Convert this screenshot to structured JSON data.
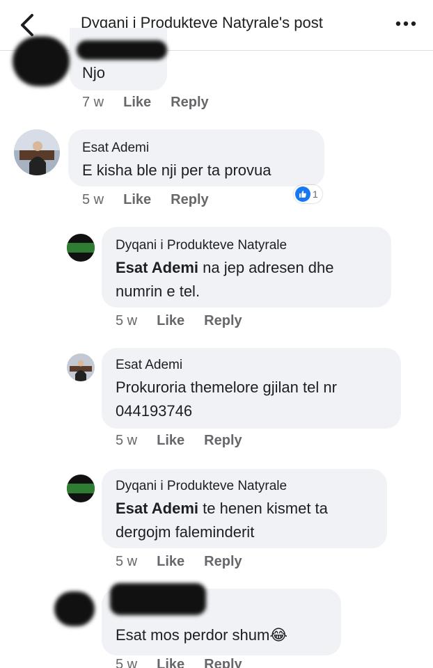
{
  "header": {
    "title": "Dyqani i Produkteve Natyrale's post"
  },
  "colors": {
    "bubble": "#f0f2f5",
    "meta": "#65676b",
    "like_blue": "#1877f2",
    "shop_green": "#2f7d32"
  },
  "comments": [
    {
      "author": "",
      "text": "Njo",
      "time": "7 w",
      "like": "Like",
      "reply": "Reply"
    },
    {
      "author": "Esat Ademi",
      "text": "E kisha ble nji per ta provua",
      "time": "5 w",
      "like": "Like",
      "reply": "Reply",
      "reaction_count": "1"
    },
    {
      "author": "Dyqani i Produkteve Natyrale",
      "mention": "Esat Ademi",
      "text_rest_1": " na jep adresen dhe",
      "text_rest_2": "numrin e tel.",
      "time": "5 w",
      "like": "Like",
      "reply": "Reply"
    },
    {
      "author": "Esat Ademi",
      "text_line_1": "Prokuroria themelore gjilan tel nr",
      "text_line_2": "044193746",
      "time": "5 w",
      "like": "Like",
      "reply": "Reply"
    },
    {
      "author": "Dyqani i Produkteve Natyrale",
      "mention": "Esat Ademi",
      "text_rest_1": " te henen kismet ta",
      "text_rest_2": "dergojm faleminderit",
      "time": "5 w",
      "like": "Like",
      "reply": "Reply"
    },
    {
      "author": "",
      "text": "Esat mos perdor shum",
      "emoji": "😂",
      "time": "5 w",
      "like": "Like",
      "reply": "Reply"
    }
  ],
  "icons": [
    "back-icon",
    "more-icon",
    "like-reaction-icon",
    "laughing-emoji-icon"
  ]
}
